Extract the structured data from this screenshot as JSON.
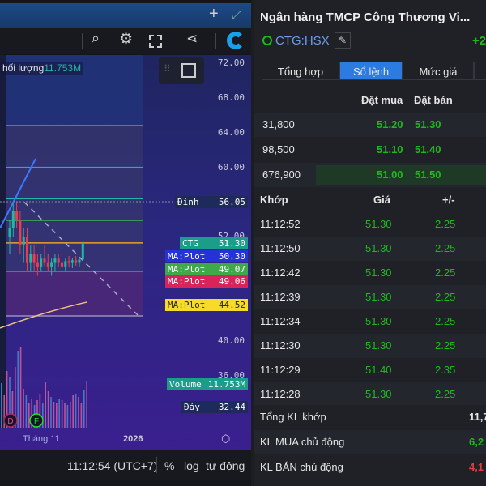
{
  "chart": {
    "legend_label": "hối lượng",
    "legend_value": "11.753M",
    "price_axis": [
      "72.00",
      "68.00",
      "64.00",
      "60.00",
      "52.00",
      "40.00",
      "36.00"
    ],
    "price_axis_values": [
      72,
      68,
      64,
      60,
      52,
      40,
      36
    ],
    "tags": {
      "dinh": {
        "label": "Đỉnh",
        "value": "56.05",
        "price": 56.05
      },
      "ctg": {
        "label": "CTG",
        "value": "51.30",
        "price": 51.3,
        "color": "#1a9e8a"
      },
      "ma1": {
        "label": "MA:Plot",
        "value": "50.30",
        "color": "#2433d6"
      },
      "ma2": {
        "label": "MA:Plot",
        "value": "49.07",
        "color": "#3fa84a"
      },
      "ma3": {
        "label": "MA:Plot",
        "value": "49.06",
        "color": "#d8245a"
      },
      "ma4": {
        "label": "MA:Plot",
        "value": "44.52",
        "color": "#f5dc2a"
      },
      "volume": {
        "label": "Volume",
        "value": "11.753M",
        "color": "#1a9e8a"
      },
      "day": {
        "label": "Đáy",
        "value": "32.44",
        "price": 32.44
      }
    },
    "levels": [
      {
        "price": 64.8,
        "color": "#9b8fb8"
      },
      {
        "price": 60,
        "color": "#22a8d8"
      },
      {
        "price": 56.4,
        "color": "#20b8a8"
      },
      {
        "price": 53.9,
        "color": "#3db84a"
      },
      {
        "price": 51.3,
        "color": "#f0a020"
      },
      {
        "price": 48,
        "color": "#e83850"
      }
    ],
    "candles": [
      [
        52,
        54,
        50,
        53
      ],
      [
        53,
        56,
        52,
        55
      ],
      [
        55,
        56,
        53,
        54
      ],
      [
        54,
        55,
        50,
        51
      ],
      [
        51,
        53,
        49,
        52
      ],
      [
        52,
        53,
        48,
        49
      ],
      [
        49,
        51,
        48,
        50
      ],
      [
        50,
        51,
        48,
        49
      ],
      [
        49,
        50,
        47.5,
        48.5
      ],
      [
        48.5,
        50,
        48,
        49.5
      ],
      [
        49.5,
        51,
        48.5,
        49
      ],
      [
        49,
        50,
        48,
        48.5
      ],
      [
        48.5,
        49.5,
        47.5,
        49
      ],
      [
        49,
        50,
        48,
        49.5
      ],
      [
        49.5,
        50,
        48.5,
        49
      ],
      [
        49,
        49.5,
        47,
        48.5
      ],
      [
        48.5,
        49.5,
        48,
        49.2
      ],
      [
        49.2,
        49.8,
        48.5,
        49
      ],
      [
        49,
        49.6,
        48.4,
        49.3
      ],
      [
        49.3,
        49.8,
        48.6,
        49
      ],
      [
        49,
        49.7,
        48.5,
        49.4
      ],
      [
        49.4,
        51.5,
        49.2,
        51.3
      ]
    ],
    "volumes": [
      55,
      40,
      70,
      62,
      45,
      75,
      95,
      100,
      48,
      40,
      30,
      36,
      28,
      34,
      42,
      30,
      56,
      45,
      38,
      32,
      30,
      36,
      34,
      30,
      28,
      32,
      40,
      42,
      38,
      30,
      46,
      58
    ],
    "markers": [
      "D",
      "F"
    ],
    "time_labels": [
      "Tháng 11",
      "2026"
    ]
  },
  "bottom": {
    "time": "11:12:54 (UTC+7)",
    "percent": "%",
    "log": "log",
    "auto": "tự động"
  },
  "panel": {
    "title": "Ngân hàng TMCP Công Thương Vi...",
    "symbol": "CTG:HSX",
    "change": "+2",
    "tabs": [
      "Tổng hợp",
      "Sổ lệnh",
      "Mức giá"
    ],
    "active_tab": 1,
    "book_headers": {
      "bid": "Đặt mua",
      "ask": "Đặt bán"
    },
    "book": [
      {
        "vol": "31,800",
        "bid": "51.20",
        "ask": "51.30"
      },
      {
        "vol": "98,500",
        "bid": "51.10",
        "ask": "51.40"
      },
      {
        "vol": "676,900",
        "bid": "51.00",
        "ask": "51.50"
      }
    ],
    "trade_headers": {
      "time": "Khớp",
      "price": "Giá",
      "change": "+/-"
    },
    "trades": [
      {
        "t": "11:12:52",
        "p": "51.30",
        "c": "2.25"
      },
      {
        "t": "11:12:50",
        "p": "51.30",
        "c": "2.25"
      },
      {
        "t": "11:12:42",
        "p": "51.30",
        "c": "2.25"
      },
      {
        "t": "11:12:39",
        "p": "51.30",
        "c": "2.25"
      },
      {
        "t": "11:12:34",
        "p": "51.30",
        "c": "2.25"
      },
      {
        "t": "11:12:30",
        "p": "51.30",
        "c": "2.25"
      },
      {
        "t": "11:12:29",
        "p": "51.40",
        "c": "2.35"
      },
      {
        "t": "11:12:28",
        "p": "51.30",
        "c": "2.25"
      }
    ],
    "summary": [
      {
        "label": "Tổng KL khớp",
        "value": "11,7"
      },
      {
        "label": "KL MUA chủ động",
        "value": "6,2"
      },
      {
        "label": "KL BÁN chủ động",
        "value": "4,1"
      }
    ]
  }
}
